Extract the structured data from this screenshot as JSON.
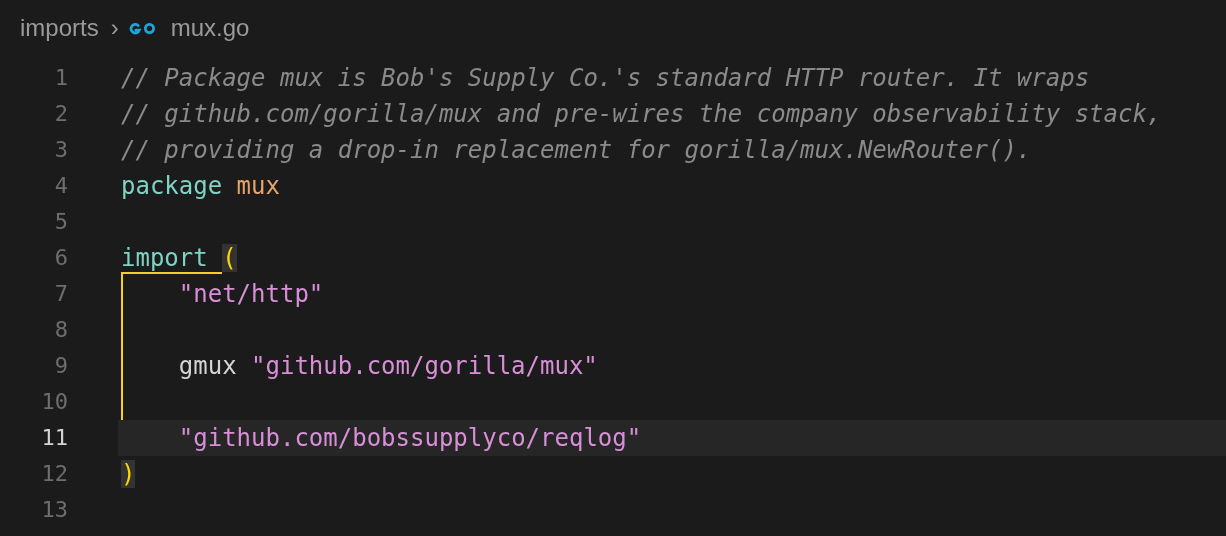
{
  "breadcrumb": {
    "folder": "imports",
    "separator": "›",
    "file": "mux.go"
  },
  "editor": {
    "lines": [
      {
        "number": "1",
        "current": false,
        "indented": false,
        "tokens": [
          {
            "kind": "comment",
            "text": "// Package mux is Bob's Supply Co.'s standard HTTP router. It wraps"
          }
        ]
      },
      {
        "number": "2",
        "current": false,
        "indented": false,
        "tokens": [
          {
            "kind": "comment",
            "text": "// github.com/gorilla/mux and pre-wires the company observability stack,"
          }
        ]
      },
      {
        "number": "3",
        "current": false,
        "indented": false,
        "tokens": [
          {
            "kind": "comment",
            "text": "// providing a drop-in replacement for gorilla/mux.NewRouter()."
          }
        ]
      },
      {
        "number": "4",
        "current": false,
        "indented": false,
        "tokens": [
          {
            "kind": "keyword",
            "text": "package"
          },
          {
            "kind": "package",
            "text": "mux"
          }
        ]
      },
      {
        "number": "5",
        "current": false
      },
      {
        "number": "6",
        "current": false,
        "indented": false,
        "tokens": [
          {
            "kind": "keyword",
            "text": "import"
          },
          {
            "kind": "bracket",
            "text": "(",
            "matched": true
          }
        ]
      },
      {
        "number": "7",
        "current": false,
        "indented": true,
        "tokens": [
          {
            "kind": "string",
            "text": "\"net/http\""
          }
        ]
      },
      {
        "number": "8",
        "current": false
      },
      {
        "number": "9",
        "current": false,
        "indented": true,
        "tokens": [
          {
            "kind": "plain",
            "text": "gmux"
          },
          {
            "kind": "string",
            "text": "\"github.com/gorilla/mux\""
          }
        ]
      },
      {
        "number": "10",
        "current": false
      },
      {
        "number": "11",
        "current": true,
        "indented": true,
        "tokens": [
          {
            "kind": "string",
            "text": "\"github.com/bobssupplyco/reqlog\""
          }
        ]
      },
      {
        "number": "12",
        "current": false,
        "indented": false,
        "tokens": [
          {
            "kind": "bracket",
            "text": ")",
            "matched": true
          }
        ]
      },
      {
        "number": "13",
        "current": false
      }
    ]
  }
}
